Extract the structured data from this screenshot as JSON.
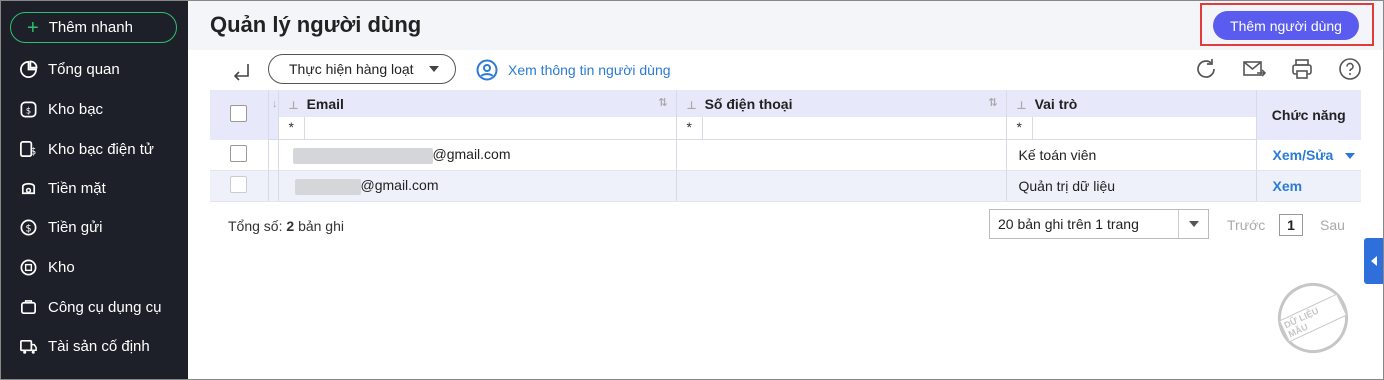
{
  "sidebar": {
    "quick_add": "Thêm nhanh",
    "items": [
      {
        "label": "Tổng quan",
        "icon": "pie-chart-icon"
      },
      {
        "label": "Kho bạc",
        "icon": "treasury-icon"
      },
      {
        "label": "Kho bạc điện tử",
        "icon": "e-treasury-icon"
      },
      {
        "label": "Tiền mặt",
        "icon": "cash-icon"
      },
      {
        "label": "Tiền gửi",
        "icon": "deposit-icon"
      },
      {
        "label": "Kho",
        "icon": "warehouse-icon"
      },
      {
        "label": "Công cụ dụng cụ",
        "icon": "tools-icon"
      },
      {
        "label": "Tài sản cố định",
        "icon": "fixed-asset-icon"
      }
    ]
  },
  "header": {
    "title": "Quản lý người dùng",
    "add_user": "Thêm người dùng"
  },
  "toolbar": {
    "bulk_action": "Thực hiện hàng loạt",
    "view_info": "Xem thông tin người dùng"
  },
  "table": {
    "columns": {
      "email": "Email",
      "phone": "Số điện thoại",
      "role": "Vai trò",
      "function": "Chức năng"
    },
    "filter_symbol": "*",
    "rows": [
      {
        "email_suffix": "@gmail.com",
        "phone": "",
        "role": "Kế toán viên",
        "action": "Xem/Sửa"
      },
      {
        "email_suffix": "@gmail.com",
        "phone": "",
        "role": "Quản trị dữ liệu",
        "action": "Xem"
      }
    ]
  },
  "footer": {
    "total_label": "Tổng số:",
    "total_count": "2",
    "total_unit": "bản ghi",
    "per_page": "20 bản ghi trên 1 trang",
    "prev": "Trước",
    "page": "1",
    "next": "Sau"
  },
  "watermark": "DỮ LIỆU MẪU",
  "colors": {
    "sidebar_bg": "#1d2028",
    "accent_green": "#2fbf71",
    "primary_button": "#5a5cf0",
    "link_blue": "#2b7bd6",
    "header_row": "#e8e8fb",
    "highlight_box": "#e23b3b"
  }
}
